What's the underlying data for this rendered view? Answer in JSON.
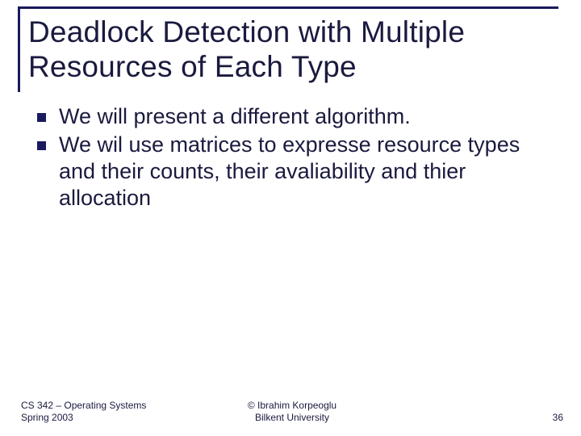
{
  "title": "Deadlock Detection with Multiple Resources of Each Type",
  "bullets": [
    "We will present a different algorithm.",
    "We wil use matrices to expresse resource types and their counts, their avaliability and thier allocation"
  ],
  "footer": {
    "left_line1": "CS 342 – Operating Systems",
    "left_line2": "Spring 2003",
    "center_line1": "© Ibrahim Korpeoglu",
    "center_line2": "Bilkent University",
    "page_number": "36"
  }
}
